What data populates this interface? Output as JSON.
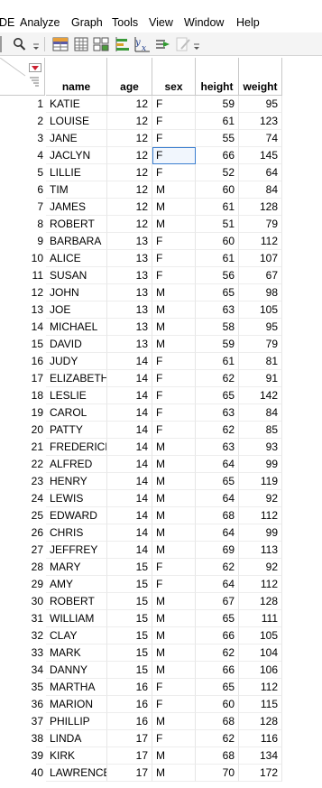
{
  "menu": {
    "items": [
      "DE",
      "Analyze",
      "Graph",
      "Tools",
      "View",
      "Window",
      "Help"
    ]
  },
  "toolbar": {
    "icons": [
      "search-icon",
      "dropdown-icon",
      "data-grid-icon",
      "table-icon",
      "layout-icon",
      "bar-chart-icon",
      "formula-icon",
      "run-script-icon",
      "edit-icon",
      "dropdown-icon"
    ]
  },
  "table": {
    "columns": [
      "name",
      "age",
      "sex",
      "height",
      "weight"
    ],
    "selected_cell": {
      "row": 4,
      "column": "sex"
    },
    "rows": [
      {
        "num": "1",
        "name": "KATIE",
        "age": "12",
        "sex": "F",
        "height": "59",
        "weight": "95"
      },
      {
        "num": "2",
        "name": "LOUISE",
        "age": "12",
        "sex": "F",
        "height": "61",
        "weight": "123"
      },
      {
        "num": "3",
        "name": "JANE",
        "age": "12",
        "sex": "F",
        "height": "55",
        "weight": "74"
      },
      {
        "num": "4",
        "name": "JACLYN",
        "age": "12",
        "sex": "F",
        "height": "66",
        "weight": "145"
      },
      {
        "num": "5",
        "name": "LILLIE",
        "age": "12",
        "sex": "F",
        "height": "52",
        "weight": "64"
      },
      {
        "num": "6",
        "name": "TIM",
        "age": "12",
        "sex": "M",
        "height": "60",
        "weight": "84"
      },
      {
        "num": "7",
        "name": "JAMES",
        "age": "12",
        "sex": "M",
        "height": "61",
        "weight": "128"
      },
      {
        "num": "8",
        "name": "ROBERT",
        "age": "12",
        "sex": "M",
        "height": "51",
        "weight": "79"
      },
      {
        "num": "9",
        "name": "BARBARA",
        "age": "13",
        "sex": "F",
        "height": "60",
        "weight": "112"
      },
      {
        "num": "10",
        "name": "ALICE",
        "age": "13",
        "sex": "F",
        "height": "61",
        "weight": "107"
      },
      {
        "num": "11",
        "name": "SUSAN",
        "age": "13",
        "sex": "F",
        "height": "56",
        "weight": "67"
      },
      {
        "num": "12",
        "name": "JOHN",
        "age": "13",
        "sex": "M",
        "height": "65",
        "weight": "98"
      },
      {
        "num": "13",
        "name": "JOE",
        "age": "13",
        "sex": "M",
        "height": "63",
        "weight": "105"
      },
      {
        "num": "14",
        "name": "MICHAEL",
        "age": "13",
        "sex": "M",
        "height": "58",
        "weight": "95"
      },
      {
        "num": "15",
        "name": "DAVID",
        "age": "13",
        "sex": "M",
        "height": "59",
        "weight": "79"
      },
      {
        "num": "16",
        "name": "JUDY",
        "age": "14",
        "sex": "F",
        "height": "61",
        "weight": "81"
      },
      {
        "num": "17",
        "name": "ELIZABETH",
        "age": "14",
        "sex": "F",
        "height": "62",
        "weight": "91"
      },
      {
        "num": "18",
        "name": "LESLIE",
        "age": "14",
        "sex": "F",
        "height": "65",
        "weight": "142"
      },
      {
        "num": "19",
        "name": "CAROL",
        "age": "14",
        "sex": "F",
        "height": "63",
        "weight": "84"
      },
      {
        "num": "20",
        "name": "PATTY",
        "age": "14",
        "sex": "F",
        "height": "62",
        "weight": "85"
      },
      {
        "num": "21",
        "name": "FREDERICK",
        "age": "14",
        "sex": "M",
        "height": "63",
        "weight": "93"
      },
      {
        "num": "22",
        "name": "ALFRED",
        "age": "14",
        "sex": "M",
        "height": "64",
        "weight": "99"
      },
      {
        "num": "23",
        "name": "HENRY",
        "age": "14",
        "sex": "M",
        "height": "65",
        "weight": "119"
      },
      {
        "num": "24",
        "name": "LEWIS",
        "age": "14",
        "sex": "M",
        "height": "64",
        "weight": "92"
      },
      {
        "num": "25",
        "name": "EDWARD",
        "age": "14",
        "sex": "M",
        "height": "68",
        "weight": "112"
      },
      {
        "num": "26",
        "name": "CHRIS",
        "age": "14",
        "sex": "M",
        "height": "64",
        "weight": "99"
      },
      {
        "num": "27",
        "name": "JEFFREY",
        "age": "14",
        "sex": "M",
        "height": "69",
        "weight": "113"
      },
      {
        "num": "28",
        "name": "MARY",
        "age": "15",
        "sex": "F",
        "height": "62",
        "weight": "92"
      },
      {
        "num": "29",
        "name": "AMY",
        "age": "15",
        "sex": "F",
        "height": "64",
        "weight": "112"
      },
      {
        "num": "30",
        "name": "ROBERT",
        "age": "15",
        "sex": "M",
        "height": "67",
        "weight": "128"
      },
      {
        "num": "31",
        "name": "WILLIAM",
        "age": "15",
        "sex": "M",
        "height": "65",
        "weight": "111"
      },
      {
        "num": "32",
        "name": "CLAY",
        "age": "15",
        "sex": "M",
        "height": "66",
        "weight": "105"
      },
      {
        "num": "33",
        "name": "MARK",
        "age": "15",
        "sex": "M",
        "height": "62",
        "weight": "104"
      },
      {
        "num": "34",
        "name": "DANNY",
        "age": "15",
        "sex": "M",
        "height": "66",
        "weight": "106"
      },
      {
        "num": "35",
        "name": "MARTHA",
        "age": "16",
        "sex": "F",
        "height": "65",
        "weight": "112"
      },
      {
        "num": "36",
        "name": "MARION",
        "age": "16",
        "sex": "F",
        "height": "60",
        "weight": "115"
      },
      {
        "num": "37",
        "name": "PHILLIP",
        "age": "16",
        "sex": "M",
        "height": "68",
        "weight": "128"
      },
      {
        "num": "38",
        "name": "LINDA",
        "age": "17",
        "sex": "F",
        "height": "62",
        "weight": "116"
      },
      {
        "num": "39",
        "name": "KIRK",
        "age": "17",
        "sex": "M",
        "height": "68",
        "weight": "134"
      },
      {
        "num": "40",
        "name": "LAWRENCE",
        "age": "17",
        "sex": "M",
        "height": "70",
        "weight": "172"
      }
    ]
  },
  "colors": {
    "selection": "#3b7ecf",
    "grid_line": "#e6e6e6",
    "header_border": "#c8c8c8",
    "red_marker": "#cc1f2f"
  }
}
